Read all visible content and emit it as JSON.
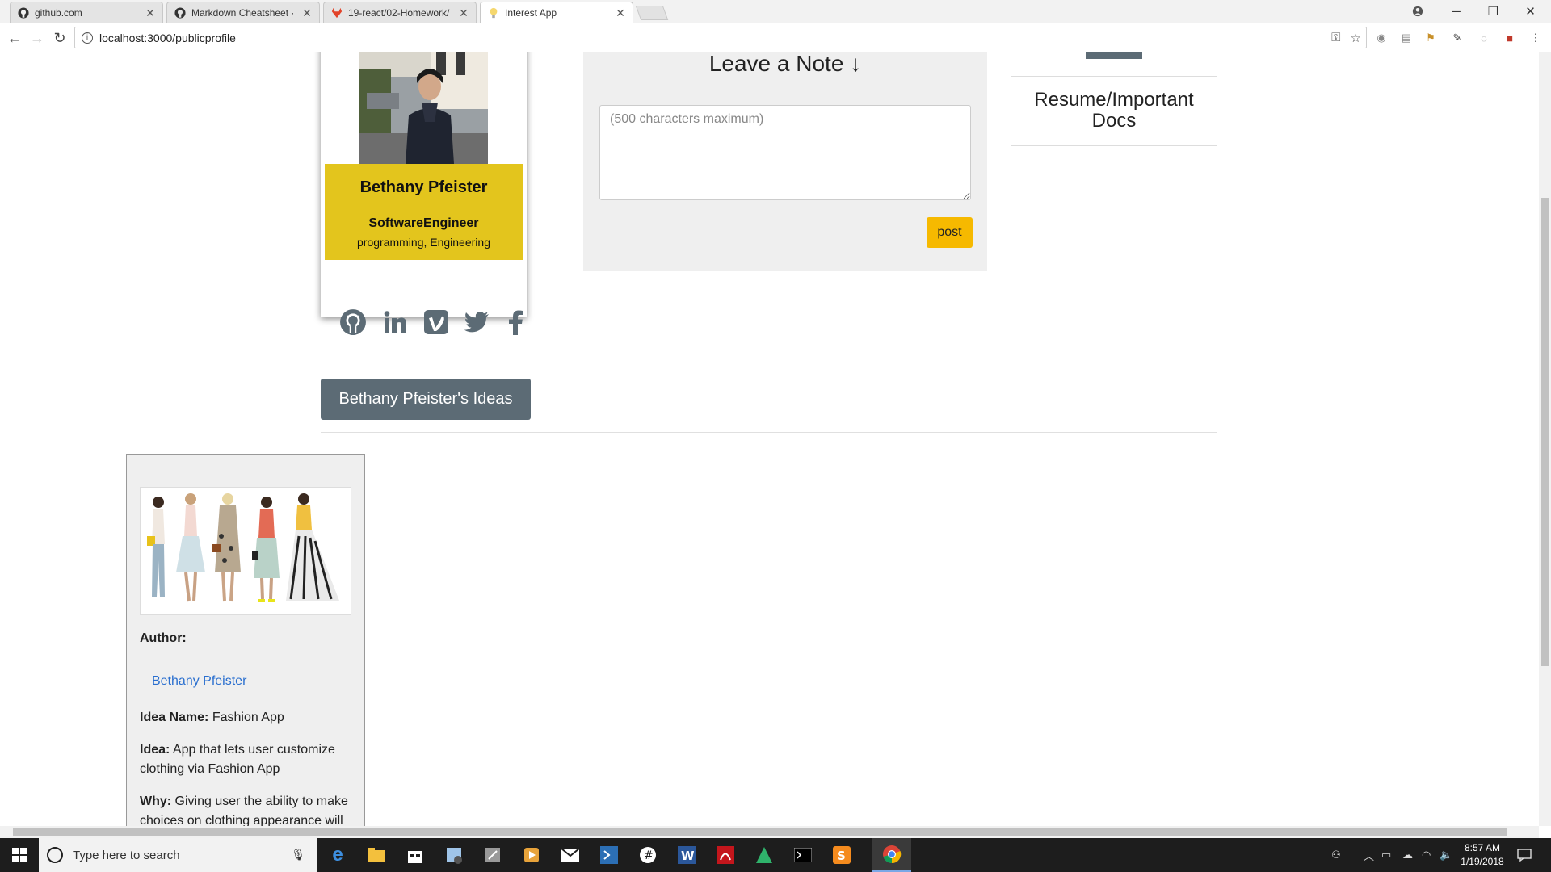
{
  "browser": {
    "tabs": [
      {
        "title": "github.com",
        "icon": "github-icon"
      },
      {
        "title": "Markdown Cheatsheet · ",
        "icon": "github-icon"
      },
      {
        "title": "19-react/02-Homework/",
        "icon": "gitlab-icon"
      },
      {
        "title": "Interest App",
        "icon": "lightbulb-icon"
      }
    ],
    "url": "localhost:3000/publicprofile"
  },
  "profile": {
    "name": "Bethany Pfeister",
    "title": "SoftwareEngineer",
    "interests": "programming, Engineering",
    "card_color": "#e3c51d"
  },
  "note": {
    "heading": "Leave a Note ↓",
    "placeholder": "(500 characters maximum)",
    "post_label": "post",
    "post_color": "#f6b900"
  },
  "resume": {
    "label": "Resume/Important Docs"
  },
  "social": [
    "github-icon",
    "linkedin-icon",
    "vimeo-icon",
    "twitter-icon",
    "facebook-icon"
  ],
  "ideas": {
    "button_label": "Bethany Pfeister's Ideas",
    "button_color": "#5c6b75"
  },
  "idea_card": {
    "author_label": "Author:",
    "author_name": "Bethany Pfeister",
    "idea_name_label": "Idea Name:",
    "idea_name": " Fashion App",
    "idea_label": "Idea:",
    "idea": " App that lets user customize clothing via Fashion App",
    "why_label": "Why:",
    "why": " Giving user the ability to make choices on clothing appearance will"
  },
  "taskbar": {
    "search_placeholder": "Type here to search",
    "time": "8:57 AM",
    "date": "1/19/2018"
  }
}
